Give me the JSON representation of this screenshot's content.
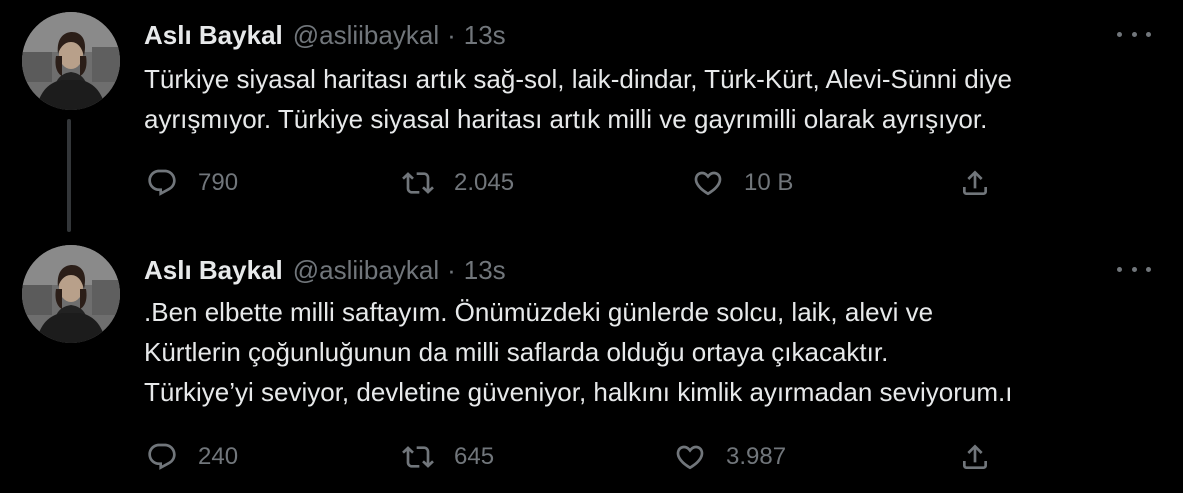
{
  "colors": {
    "background": "#000000",
    "text_primary": "#e7e9ea",
    "text_secondary": "#71767b",
    "thread_line": "#333639"
  },
  "tweets": [
    {
      "author": {
        "name": "Aslı Baykal",
        "handle": "@asliibaykal",
        "avatar_icon": "profile-photo"
      },
      "separator": "·",
      "time": "13s",
      "text_lines": [
        "Türkiye siyasal haritası artık sağ-sol, laik-dindar, Türk-Kürt, Alevi-Sünni diye",
        "ayrışmıyor. Türkiye siyasal haritası artık milli ve gayrımilli olarak ayrışıyor."
      ],
      "stats": {
        "replies": "790",
        "retweets": "2.045",
        "likes": "10 B"
      }
    },
    {
      "author": {
        "name": "Aslı Baykal",
        "handle": "@asliibaykal",
        "avatar_icon": "profile-photo"
      },
      "separator": "·",
      "time": "13s",
      "text_lines": [
        ".Ben elbette milli saftayım. Önümüzdeki günlerde solcu, laik, alevi ve",
        "Kürtlerin çoğunluğunun da milli saflarda olduğu ortaya çıkacaktır.",
        "Türkiye’yi seviyor, devletine güveniyor, halkını kimlik ayırmadan seviyorum.ı"
      ],
      "stats": {
        "replies": "240",
        "retweets": "645",
        "likes": "3.987"
      }
    }
  ],
  "icons": {
    "reply": "reply-icon",
    "retweet": "retweet-icon",
    "like": "heart-icon",
    "share": "share-icon",
    "more": "more-icon"
  }
}
